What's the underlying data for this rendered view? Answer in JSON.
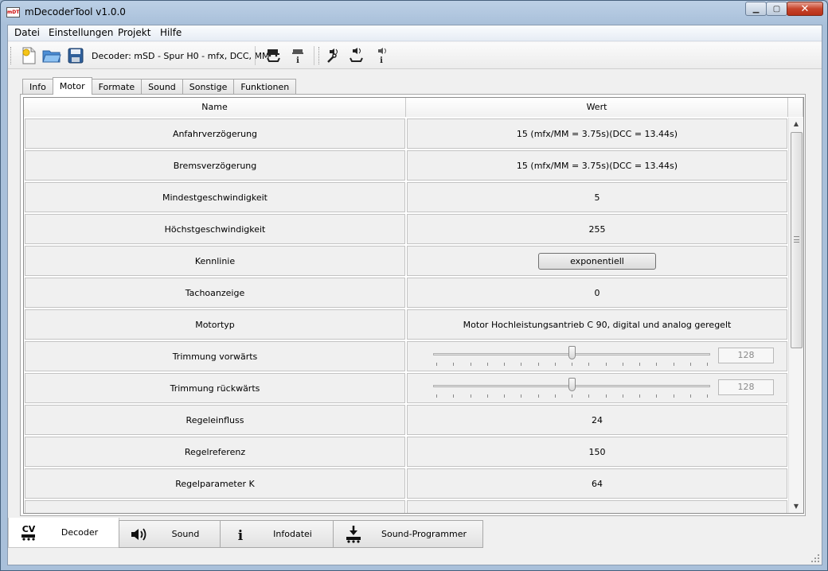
{
  "window": {
    "title": "mDecoderTool v1.0.0",
    "app_icon_text": "mDT",
    "buttons": {
      "minimize": "▁",
      "maximize": "▢",
      "close": "✕"
    }
  },
  "menu": {
    "items": [
      "Datei",
      "Einstellungen",
      "Projekt",
      "Hilfe"
    ]
  },
  "toolbar": {
    "decoder_label": "Decoder: mSD - Spur H0 - mfx, DCC, MM",
    "icons": [
      "new-file-icon",
      "open-folder-icon",
      "save-disk-icon",
      "locomotive-write-icon",
      "locomotive-info-icon",
      "sound-tools-icon",
      "sound-write-icon",
      "sound-info-icon"
    ]
  },
  "tabs": {
    "items": [
      "Info",
      "Motor",
      "Formate",
      "Sound",
      "Sonstige",
      "Funktionen"
    ],
    "active": "Motor"
  },
  "table": {
    "headers": {
      "name": "Name",
      "wert": "Wert"
    },
    "rows": [
      {
        "name": "Anfahrverzögerung",
        "value": "15 (mfx/MM = 3.75s)(DCC = 13.44s)"
      },
      {
        "name": "Bremsverzögerung",
        "value": "15 (mfx/MM = 3.75s)(DCC = 13.44s)"
      },
      {
        "name": "Mindestgeschwindigkeit",
        "value": "5"
      },
      {
        "name": "Höchstgeschwindigkeit",
        "value": "255"
      },
      {
        "name": "Kennlinie",
        "value": "exponentiell"
      },
      {
        "name": "Tachoanzeige",
        "value": "0"
      },
      {
        "name": "Motortyp",
        "value": "Motor Hochleistungsantrieb C 90, digital und analog geregelt"
      },
      {
        "name": "Trimmung vorwärts",
        "value": "128",
        "slider_fraction": 0.5
      },
      {
        "name": "Trimmung rückwärts",
        "value": "128",
        "slider_fraction": 0.5
      },
      {
        "name": "Regeleinfluss",
        "value": "24"
      },
      {
        "name": "Regelreferenz",
        "value": "150"
      },
      {
        "name": "Regelparameter K",
        "value": "64"
      },
      {
        "name": "",
        "value": ""
      }
    ]
  },
  "bottom_tabs": {
    "items": [
      {
        "label": "Decoder",
        "icon": "cv-locomotive-icon",
        "icon_text": "CV"
      },
      {
        "label": "Sound",
        "icon": "speaker-icon"
      },
      {
        "label": "Infodatei",
        "icon": "info-icon",
        "icon_text": "i"
      },
      {
        "label": "Sound-Programmer",
        "icon": "download-locomotive-icon"
      }
    ],
    "active": "Decoder"
  },
  "colors": {
    "title_gradient": "#a9c0da",
    "cell_bg": "#f0f0f0",
    "close_button": "#c7452c"
  }
}
